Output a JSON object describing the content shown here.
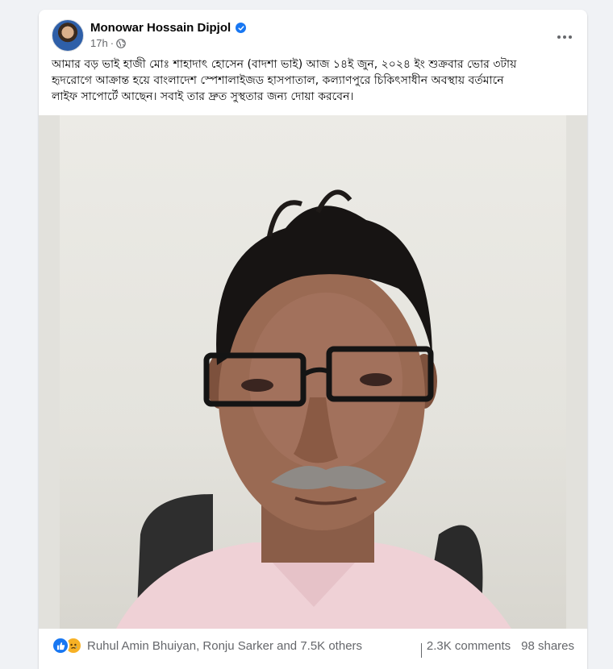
{
  "post": {
    "author": "Monowar Hossain Dipjol",
    "time": "17h",
    "separator": "·",
    "text": "আমার বড় ভাই হাজী মোঃ শাহাদাৎ হোসেন (বাদশা ভাই) আজ ১৪ই জুন, ২০২৪ ইং শুক্রবার ভোর ৩টায়\nহৃদরোগে আক্রান্ত হয়ে বাংলাদেশ স্পেশালাইজড হাসপাতাল, কল্যাণপুরে চিকিৎসাধীন অবস্থায় বর্তমানে\nলাইফ সাপোর্টে আছেন। সবাই তার দ্রুত সুস্থতার জন্য দোয়া করবেন।"
  },
  "icons": {
    "verified": "verified-badge-icon",
    "audience": "globe-icon",
    "more": "more-options-icon",
    "reactions": [
      "like-icon",
      "sad-icon"
    ]
  },
  "footer": {
    "reactions_summary": "Ruhul Amin Bhuiyan, Ronju Sarker and 7.5K others",
    "comments": "2.3K comments",
    "shares": "98 shares"
  },
  "colors": {
    "brand_blue": "#1877f2",
    "secondary_text": "#65676b",
    "primary_text": "#050505",
    "sad_yellow": "#f7b125"
  }
}
